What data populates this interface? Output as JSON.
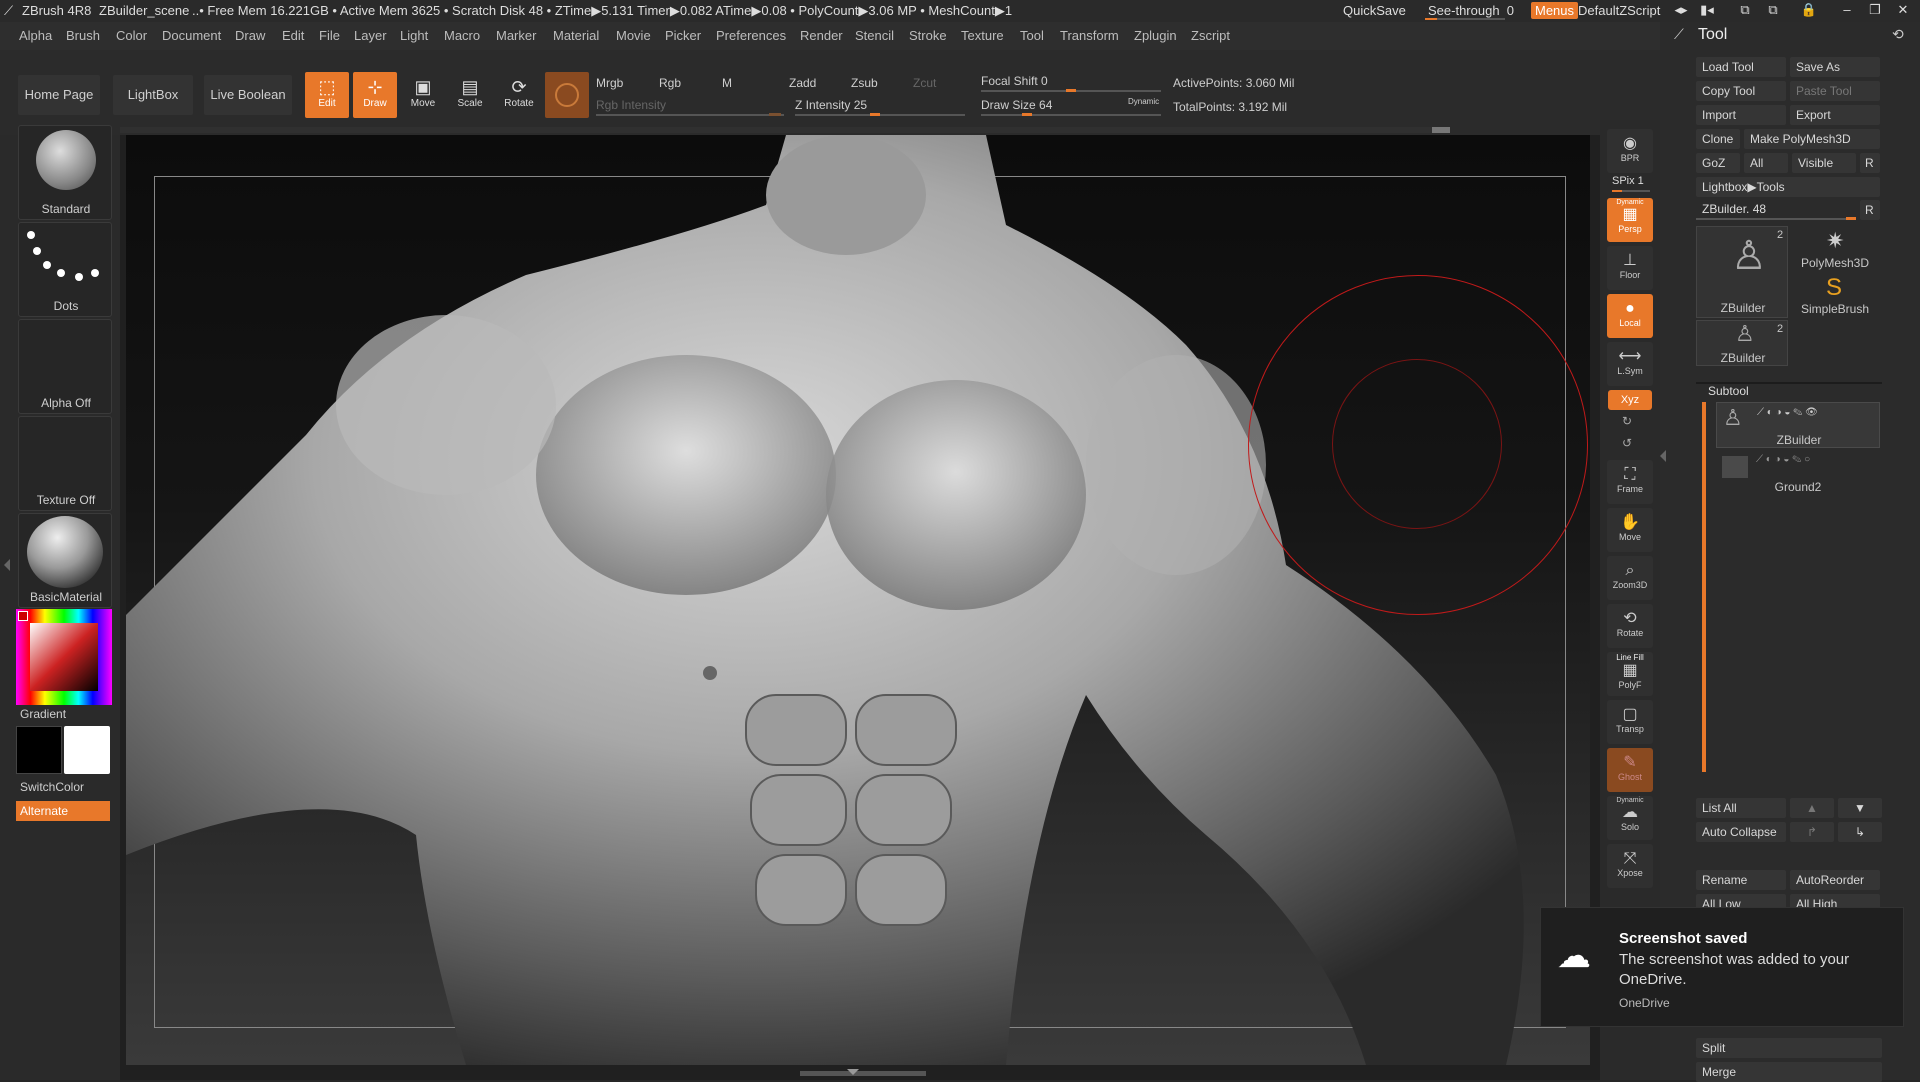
{
  "titlebar": {
    "app": "ZBrush 4R8",
    "scene": "ZBuilder_scene",
    "stats": "..• Free Mem 16.221GB • Active Mem 3625 • Scratch Disk 48 • ZTime▶5.131 Timer▶0.082 ATime▶0.08 • PolyCount▶3.06 MP • MeshCount▶1",
    "quicksave": "QuickSave",
    "seethrough": "See-through",
    "seethrough_value": "0",
    "menus": "Menus",
    "script": "DefaultZScript"
  },
  "menubar": {
    "items": [
      "Alpha",
      "Brush",
      "Color",
      "Document",
      "Draw",
      "Edit",
      "File",
      "Layer",
      "Light",
      "Macro",
      "Marker",
      "Material",
      "Movie",
      "Picker",
      "Preferences",
      "Render",
      "Stencil",
      "Stroke",
      "Texture",
      "Tool",
      "Transform",
      "Zplugin",
      "Zscript"
    ]
  },
  "toolbar": {
    "home": "Home Page",
    "lightbox": "LightBox",
    "liveboolean": "Live Boolean",
    "edit": "Edit",
    "draw": "Draw",
    "move": "Move",
    "scale": "Scale",
    "rotate": "Rotate",
    "mrgb": "Mrgb",
    "rgb": "Rgb",
    "m": "M",
    "rgb_intensity": "Rgb Intensity",
    "zadd": "Zadd",
    "zsub": "Zsub",
    "zcut": "Zcut",
    "z_intensity": "Z Intensity 25",
    "focal_shift": "Focal Shift 0",
    "draw_size": "Draw Size 64",
    "dynamic": "Dynamic",
    "active_points": "ActivePoints: 3.060 Mil",
    "total_points": "TotalPoints: 3.192 Mil"
  },
  "leftpanel": {
    "brush": "Standard",
    "stroke": "Dots",
    "alpha": "Alpha Off",
    "texture": "Texture Off",
    "material": "BasicMaterial",
    "gradient": "Gradient",
    "switchcolor": "SwitchColor",
    "alternate": "Alternate"
  },
  "shelf": {
    "bpr": "BPR",
    "spix": "SPix 1",
    "persp_top": "Dynamic",
    "persp": "Persp",
    "floor": "Floor",
    "local": "Local",
    "lsym": "L.Sym",
    "xyz": "Xyz",
    "frame": "Frame",
    "move": "Move",
    "zoom": "Zoom3D",
    "rotate": "Rotate",
    "linefill": "Line Fill",
    "polyf": "PolyF",
    "transp": "Transp",
    "ghost": "Ghost",
    "solo_top": "Dynamic",
    "solo": "Solo",
    "xpose": "Xpose"
  },
  "toolpanel": {
    "title": "Tool",
    "load": "Load Tool",
    "saveas": "Save As",
    "copy": "Copy Tool",
    "paste": "Paste Tool",
    "import": "Import",
    "export": "Export",
    "clone": "Clone",
    "makepoly": "Make PolyMesh3D",
    "goz": "GoZ",
    "all": "All",
    "visible": "Visible",
    "r": "R",
    "lightbox_tools": "Lightbox▶Tools",
    "zbuilder_slider": "ZBuilder. 48",
    "thumb1": "ZBuilder",
    "thumb1_count": "2",
    "thumb2": "PolyMesh3D",
    "thumb3": "SimpleBrush",
    "thumb4": "ZBuilder",
    "thumb4_count": "2",
    "subtool": "Subtool",
    "sub1": "ZBuilder",
    "sub2": "Ground2",
    "listall": "List All",
    "autocollapse": "Auto Collapse",
    "rename": "Rename",
    "autoreorder": "AutoReorder",
    "alllow": "All Low",
    "allhigh": "All High",
    "split": "Split",
    "merge": "Merge"
  },
  "toast": {
    "title": "Screenshot saved",
    "body": "The screenshot was added to your OneDrive.",
    "source": "OneDrive"
  }
}
